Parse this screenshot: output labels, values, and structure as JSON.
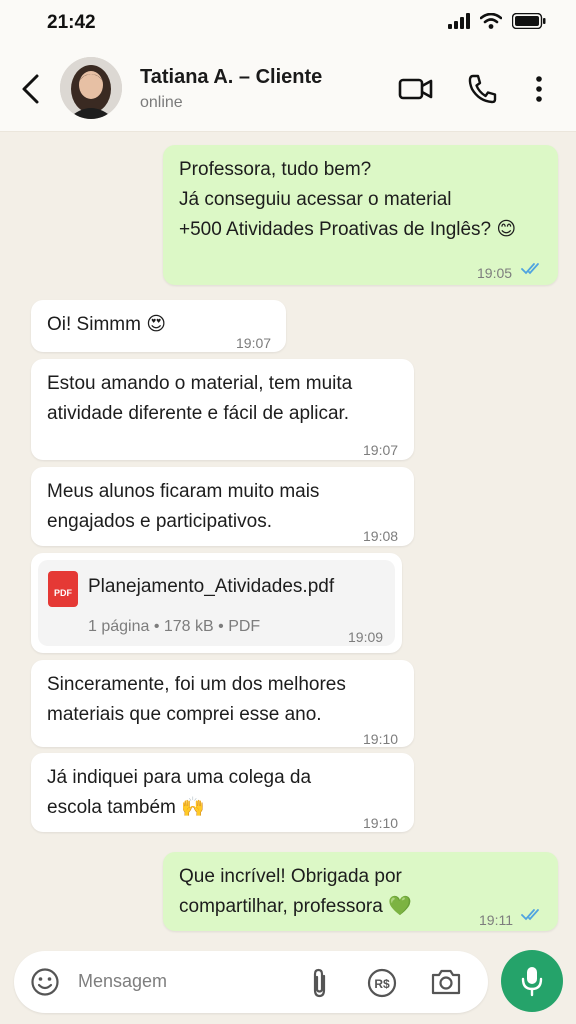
{
  "status_bar": {
    "time": "21:42",
    "icons": [
      "signal-icon",
      "wifi-icon",
      "battery-icon"
    ]
  },
  "header": {
    "contact_name": "Tatiana A. – Cliente",
    "contact_status": "online",
    "icons": [
      "back-icon",
      "avatar",
      "video-call-icon",
      "phone-icon",
      "more-options-icon"
    ]
  },
  "messages": [
    {
      "direction": "outgoing",
      "lines": [
        "Professora, tudo bem?",
        "Já conseguiu acessar o material",
        "+500 Atividades Proativas de Inglês? 😊"
      ],
      "time": "19:05",
      "read": true
    },
    {
      "direction": "incoming",
      "lines": [
        "Oi! Simmm 😍"
      ],
      "time": "19:07"
    },
    {
      "direction": "incoming",
      "lines": [
        "Estou amando o material, tem muita",
        "atividade diferente e fácil de aplicar."
      ],
      "time": "19:07"
    },
    {
      "direction": "incoming",
      "lines": [
        "Meus alunos ficaram muito mais",
        "engajados e participativos."
      ],
      "time": "19:08"
    },
    {
      "direction": "incoming",
      "type": "file",
      "file_name": "Planejamento_Atividades.pdf",
      "file_meta": "1 página • 178 kB • PDF",
      "file_icon_label": "PDF",
      "time": "19:09"
    },
    {
      "direction": "incoming",
      "lines": [
        "Sinceramente, foi um dos melhores",
        "materiais que comprei esse ano."
      ],
      "time": "19:10"
    },
    {
      "direction": "incoming",
      "lines": [
        "Já indiquei para uma colega da",
        "escola também 🙌"
      ],
      "time": "19:10"
    },
    {
      "direction": "outgoing",
      "lines": [
        "Que incrível! Obrigada por",
        "compartilhar, professora 💚"
      ],
      "time": "19:11",
      "read": true
    }
  ],
  "input": {
    "placeholder": "Mensagem",
    "icons": [
      "emoji-icon",
      "attach-icon",
      "payment-icon",
      "camera-icon",
      "mic-icon"
    ]
  },
  "colors": {
    "outgoing_bubble": "#dcf8c6",
    "incoming_bubble": "#ffffff",
    "chat_background": "#f3efe7",
    "read_ticks": "#4fa3e0",
    "mic_button": "#25a36a",
    "pdf_icon": "#e53935"
  }
}
